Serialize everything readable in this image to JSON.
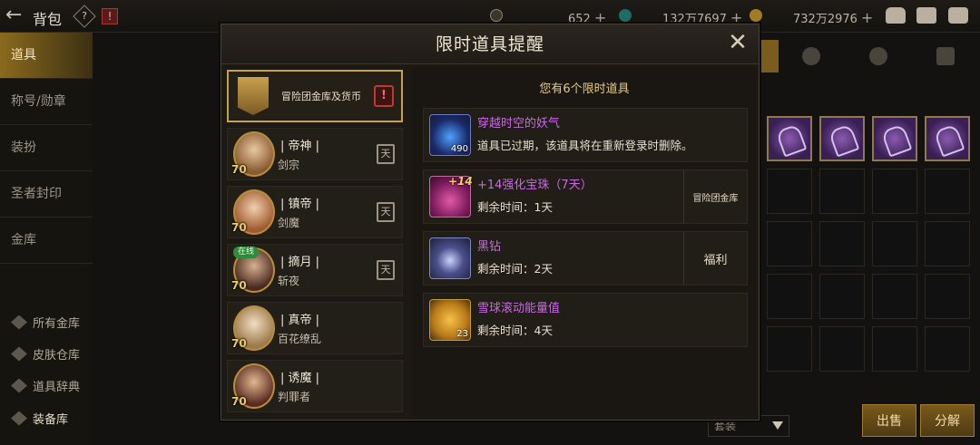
{
  "topbar": {
    "title": "背包",
    "help_symbol": "?",
    "alert_symbol": "!",
    "currencies": [
      {
        "icon": "coin-icon",
        "value": "652"
      },
      {
        "icon": "gem-icon",
        "value": "132万7697"
      },
      {
        "icon": "gold-icon",
        "value": "732万2976"
      }
    ],
    "plus_label": "+"
  },
  "sidebar": {
    "items": [
      {
        "label": "道具",
        "active": true
      },
      {
        "label": "称号/勋章"
      },
      {
        "label": "装扮"
      },
      {
        "label": "圣者封印"
      },
      {
        "label": "金库"
      }
    ],
    "sub_items": [
      {
        "label": "所有金库"
      },
      {
        "label": "皮肤仓库"
      },
      {
        "label": "道具辞典"
      },
      {
        "label": "装备库"
      }
    ]
  },
  "bottom": {
    "set_select": "套装",
    "sell_button": "出售",
    "disassemble_button": "分解"
  },
  "modal": {
    "title": "限时道具提醒",
    "close_symbol": "✕",
    "count_text": "您有6个限时道具",
    "guild_entry": {
      "label": "冒险团金库及货币",
      "badge": "!"
    },
    "characters": [
      {
        "name": "| 帝神 |",
        "class": "剑宗",
        "level": "70",
        "online": false,
        "badge": "天"
      },
      {
        "name": "| 镇帝 |",
        "class": "剑魔",
        "level": "70",
        "online": false,
        "badge": "天"
      },
      {
        "name": "| 摘月 |",
        "class": "斩夜",
        "level": "70",
        "online": true,
        "online_label": "在线",
        "badge": "天"
      },
      {
        "name": "| 真帝 |",
        "class": "百花缭乱",
        "level": "70",
        "online": false
      },
      {
        "name": "| 诱魔 |",
        "class": "判罪者",
        "level": "70",
        "online": false
      }
    ],
    "items": [
      {
        "name": "穿越时空的妖气",
        "desc": "道具已过期，该道具将在重新登录时删除。",
        "count": "490",
        "tag": ""
      },
      {
        "name": "+14强化宝珠（7天）",
        "desc": "剩余时间：1天",
        "count": "",
        "tag": "冒险团金库",
        "badge": "+14"
      },
      {
        "name": "黑钻",
        "desc": "剩余时间：2天",
        "count": "",
        "tag": "福利"
      },
      {
        "name": "雪球滚动能量值",
        "desc": "剩余时间：4天",
        "count": "23",
        "tag": ""
      }
    ]
  }
}
